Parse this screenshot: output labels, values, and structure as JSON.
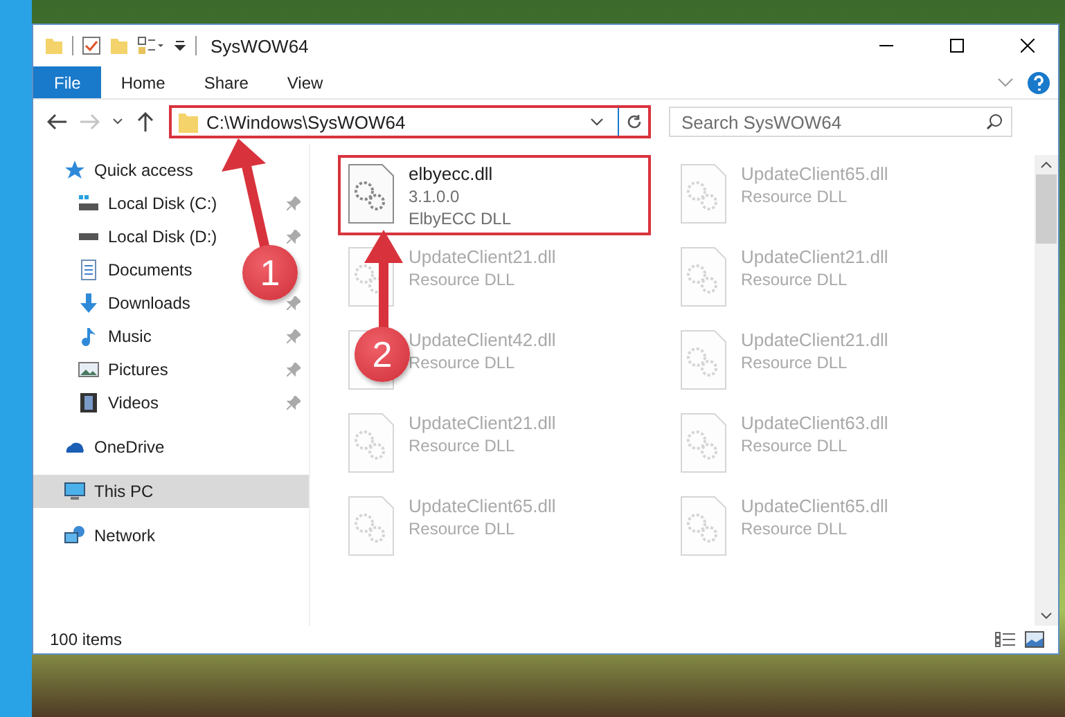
{
  "window": {
    "title": "SysWOW64"
  },
  "ribbon": {
    "tabs": [
      {
        "label": "File",
        "kind": "file-menu"
      },
      {
        "label": "Home",
        "kind": "tab"
      },
      {
        "label": "Share",
        "kind": "tab"
      },
      {
        "label": "View",
        "kind": "tab"
      }
    ]
  },
  "address_bar": {
    "path": "C:\\Windows\\SysWOW64",
    "highlighted": true
  },
  "search": {
    "placeholder": "Search SysWOW64"
  },
  "navigation": [
    {
      "label": "Quick access",
      "kind": "star",
      "selected": false,
      "children": [
        {
          "label": "Local Disk (C:)",
          "kind": "system-drive",
          "pinned": true,
          "selected": false
        },
        {
          "label": "Local Disk (D:)",
          "kind": "drive",
          "pinned": true,
          "selected": false
        },
        {
          "label": "Documents",
          "kind": "documents",
          "pinned": false,
          "selected": false
        },
        {
          "label": "Downloads",
          "kind": "downloads",
          "pinned": true,
          "selected": false
        },
        {
          "label": "Music",
          "kind": "music",
          "pinned": true,
          "selected": false
        },
        {
          "label": "Pictures",
          "kind": "pictures",
          "pinned": true,
          "selected": false
        },
        {
          "label": "Videos",
          "kind": "videos",
          "pinned": true,
          "selected": false
        }
      ]
    },
    {
      "label": "OneDrive",
      "kind": "cloud",
      "selected": false
    },
    {
      "label": "This PC",
      "kind": "pc",
      "selected": true
    },
    {
      "label": "Network",
      "kind": "network",
      "selected": false
    }
  ],
  "files": [
    {
      "name": "elbyecc.dll",
      "version": "3.1.0.0",
      "description": "ElbyECC DLL",
      "highlighted": true,
      "faded": false
    },
    {
      "name": "UpdateClient65.dll",
      "description": "Resource DLL",
      "highlighted": false,
      "faded": true
    },
    {
      "name": "UpdateClient21.dll",
      "description": "Resource DLL",
      "highlighted": false,
      "faded": true
    },
    {
      "name": "UpdateClient21.dll",
      "description": "Resource DLL",
      "highlighted": false,
      "faded": true
    },
    {
      "name": "UpdateClient42.dll",
      "description": "Resource DLL",
      "highlighted": false,
      "faded": true
    },
    {
      "name": "UpdateClient21.dll",
      "description": "Resource DLL",
      "highlighted": false,
      "faded": true
    },
    {
      "name": "UpdateClient21.dll",
      "description": "Resource DLL",
      "highlighted": false,
      "faded": true
    },
    {
      "name": "UpdateClient63.dll",
      "description": "Resource DLL",
      "highlighted": false,
      "faded": true
    },
    {
      "name": "UpdateClient65.dll",
      "description": "Resource DLL",
      "highlighted": false,
      "faded": true
    },
    {
      "name": "UpdateClient65.dll",
      "description": "Resource DLL",
      "highlighted": false,
      "faded": true
    }
  ],
  "status_bar": {
    "item_count": "100 items"
  },
  "annotations": [
    {
      "label": "1"
    },
    {
      "label": "2"
    }
  ]
}
